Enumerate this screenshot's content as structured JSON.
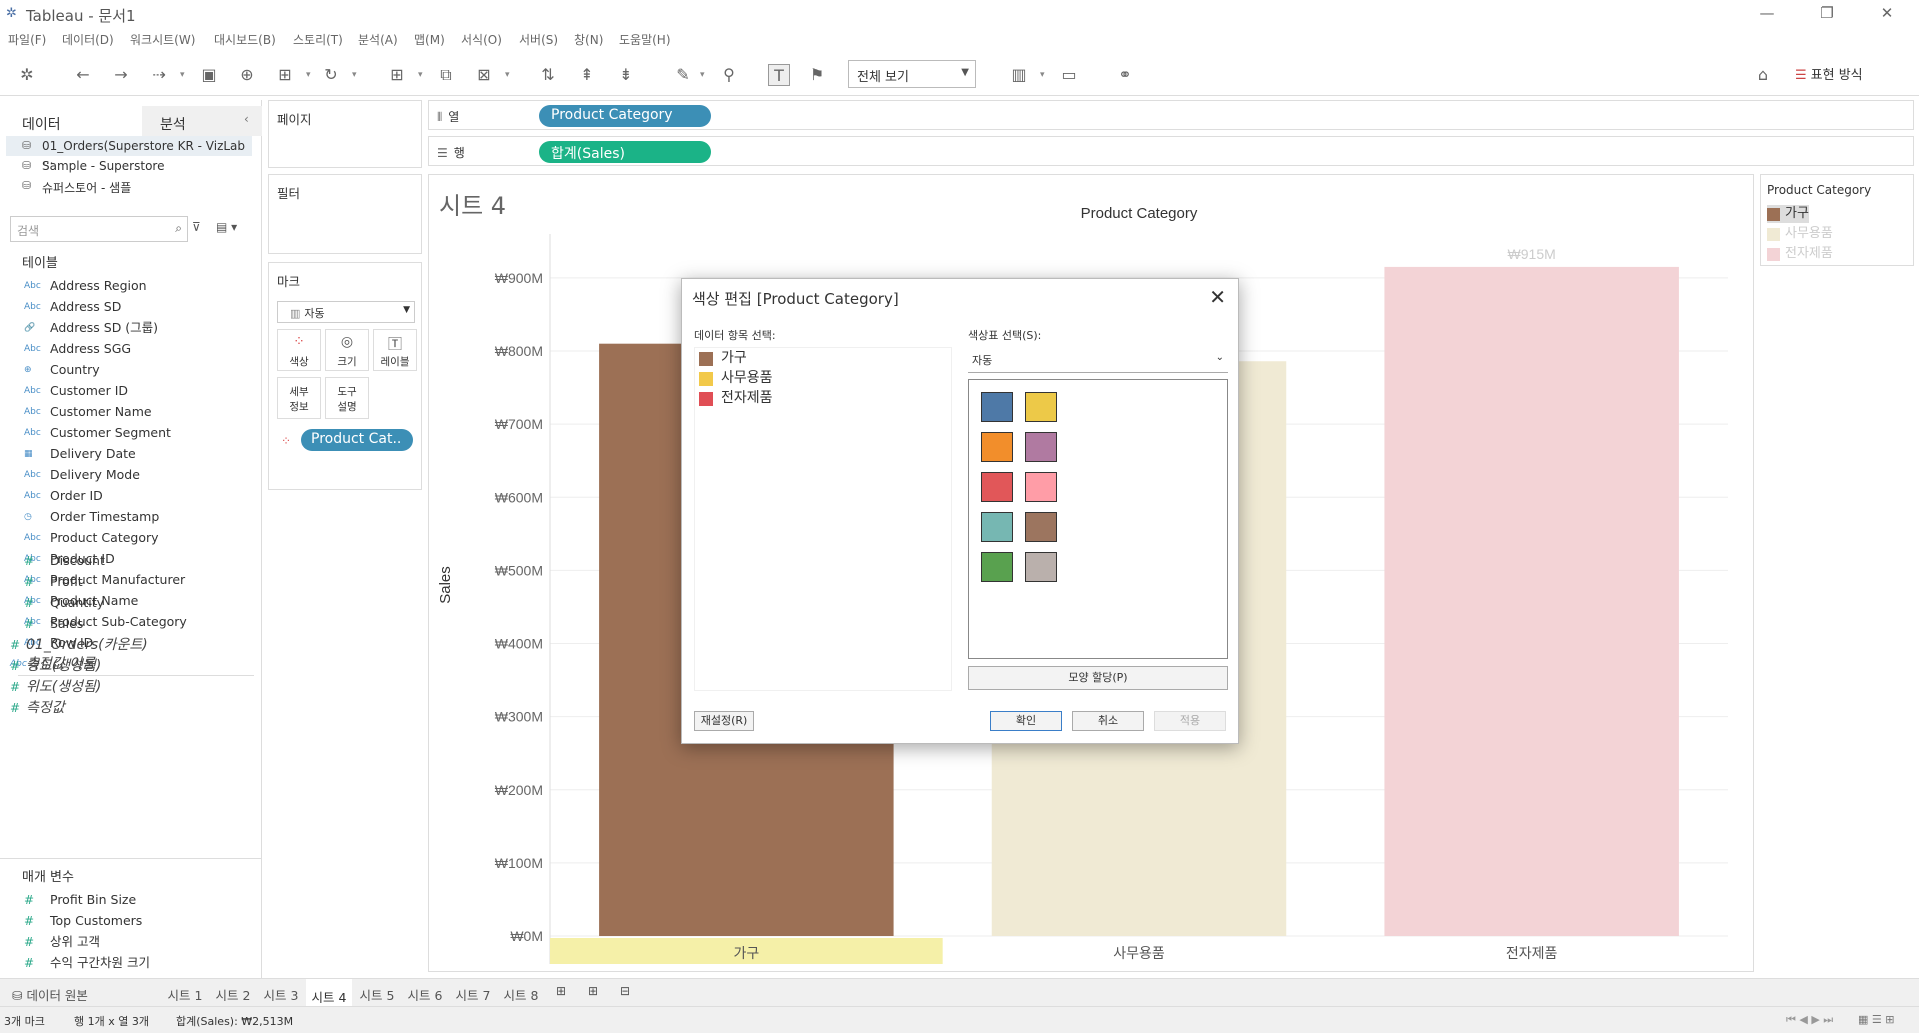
{
  "window": {
    "title": "Tableau - 문서1"
  },
  "menu": [
    "파일(F)",
    "데이터(D)",
    "워크시트(W)",
    "대시보드(B)",
    "스토리(T)",
    "분석(A)",
    "맵(M)",
    "서식(O)",
    "서버(S)",
    "창(N)",
    "도움말(H)"
  ],
  "toolbar": {
    "view_select": "전체 보기",
    "show_me": "표현 방식"
  },
  "left": {
    "tab_data": "데이터",
    "tab_analysis": "분석",
    "sources": [
      "01_Orders(Superstore KR - VizLab ...",
      "Sample - Superstore",
      "슈퍼스토어 - 샘플"
    ],
    "search_placeholder": "검색",
    "tables_title": "테이블",
    "dims": [
      {
        "icon": "Abc",
        "name": "Address Region"
      },
      {
        "icon": "Abc",
        "name": "Address SD"
      },
      {
        "icon": "🔗",
        "name": "Address SD (그룹)"
      },
      {
        "icon": "Abc",
        "name": "Address SGG"
      },
      {
        "icon": "⊕",
        "name": "Country"
      },
      {
        "icon": "Abc",
        "name": "Customer ID"
      },
      {
        "icon": "Abc",
        "name": "Customer Name"
      },
      {
        "icon": "Abc",
        "name": "Customer Segment"
      },
      {
        "icon": "▦",
        "name": "Delivery Date"
      },
      {
        "icon": "Abc",
        "name": "Delivery Mode"
      },
      {
        "icon": "Abc",
        "name": "Order ID"
      },
      {
        "icon": "◷",
        "name": "Order Timestamp"
      },
      {
        "icon": "Abc",
        "name": "Product Category"
      },
      {
        "icon": "Abc",
        "name": "Product ID"
      },
      {
        "icon": "Abc",
        "name": "Product Manufacturer"
      },
      {
        "icon": "Abc",
        "name": "Product Name"
      },
      {
        "icon": "Abc",
        "name": "Product Sub-Category"
      },
      {
        "icon": "Abc",
        "name": "Row ID"
      },
      {
        "icon": "Abc",
        "name": "측정값 이름"
      }
    ],
    "measures": [
      "Discount",
      "Profit",
      "Quantity",
      "Sales",
      "01_Orders(카운트)",
      "경도(생성됨)",
      "위도(생성됨)",
      "측정값"
    ],
    "params_title": "매개 변수",
    "params": [
      "Profit Bin Size",
      "Top Customers",
      "상위 고객",
      "수익 구간차원 크기"
    ]
  },
  "cards": {
    "pages": "페이지",
    "filters": "필터",
    "marks": "마크",
    "mark_type": "자동",
    "btn_color": "색상",
    "btn_size": "크기",
    "btn_label": "레이블",
    "btn_detail": "세부\n정보",
    "btn_tooltip": "도구\n설명",
    "mark_pill": "Product Cat.."
  },
  "shelves": {
    "columns_label": "열",
    "columns_pill": "Product Category",
    "rows_label": "행",
    "rows_pill": "합계(Sales)"
  },
  "sheet": {
    "title": "시트 4"
  },
  "chart_data": {
    "type": "bar",
    "title": "Product Category",
    "ylabel": "Sales",
    "categories": [
      "가구",
      "사무용품",
      "전자제품"
    ],
    "values": [
      810,
      786,
      915
    ],
    "ylim": [
      0,
      960
    ],
    "yticks": [
      "₩0M",
      "₩100M",
      "₩200M",
      "₩300M",
      "₩400M",
      "₩500M",
      "₩600M",
      "₩700M",
      "₩800M",
      "₩900M"
    ],
    "data_labels": [
      "",
      "",
      "₩915M"
    ],
    "colors": [
      "#9c7055",
      "#f0ead4",
      "#f3d3d6"
    ],
    "highlighted": "가구",
    "grid": true
  },
  "legend": {
    "title": "Product Category",
    "items": [
      {
        "label": "가구",
        "color": "#9c7055"
      },
      {
        "label": "사무용품",
        "color": "#f0ead4"
      },
      {
        "label": "전자제품",
        "color": "#f3d3d6"
      }
    ]
  },
  "dialog": {
    "title": "색상 편집 [Product Category]",
    "items_label": "데이터 항목 선택:",
    "items": [
      {
        "label": "가구",
        "color": "#9c7055"
      },
      {
        "label": "사무용품",
        "color": "#f2c94a"
      },
      {
        "label": "전자제품",
        "color": "#e04e55"
      }
    ],
    "palette_label": "색상표 선택(S):",
    "palette_value": "자동",
    "palette": [
      "#4e79a7",
      "#edc948",
      "#f28e2b",
      "#b07aa1",
      "#e15759",
      "#ff9da7",
      "#76b7b2",
      "#9c755f",
      "#59a14f",
      "#bab0ac"
    ],
    "assign_btn": "모양 할당(P)",
    "reset_btn": "재설정(R)",
    "ok_btn": "확인",
    "cancel_btn": "취소",
    "apply_btn": "적용"
  },
  "tabs": {
    "source": "데이터 원본",
    "sheets": [
      "시트 1",
      "시트 2",
      "시트 3",
      "시트 4",
      "시트 5",
      "시트 6",
      "시트 7",
      "시트 8"
    ],
    "active": "시트 4"
  },
  "status": {
    "marks": "3개 마크",
    "rowscols": "행 1개 x 열 3개",
    "sum": "합계(Sales): ₩2,513M"
  }
}
